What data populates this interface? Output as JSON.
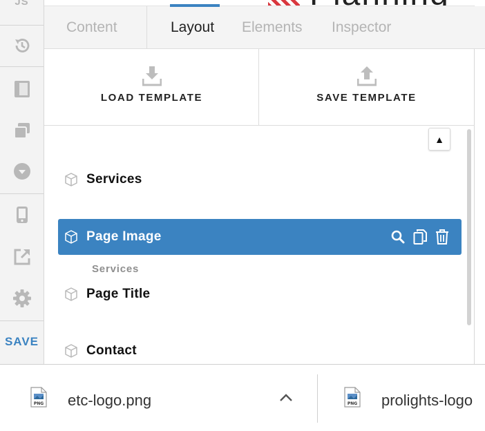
{
  "sidebar": {
    "top_label": "JS",
    "icons": [
      "history-icon",
      "sidebar-panel-icon",
      "stack-icon",
      "chevron-down-circle-icon",
      "mobile-icon",
      "external-link-icon",
      "gear-icon"
    ],
    "save_label": "SAVE"
  },
  "tabs": [
    "Content",
    "Layout",
    "Elements",
    "Inspector"
  ],
  "active_tab": "Layout",
  "templates": {
    "load_label": "LOAD TEMPLATE",
    "save_label": "SAVE TEMPLATE"
  },
  "layout_list": {
    "items": [
      {
        "name": "Services",
        "selected": false
      },
      {
        "name": "Page Image",
        "selected": true
      },
      {
        "name": "Page Title",
        "selected": false
      },
      {
        "name": "Contact",
        "selected": false
      }
    ],
    "group_label": "Services",
    "selected_actions": [
      "search-icon",
      "copy-icon",
      "trash-icon"
    ],
    "scroll_up_glyph": "▲"
  },
  "downloads": [
    {
      "name": "etc-logo.png",
      "icon_badge": "PNG"
    },
    {
      "name": "prolights-logo",
      "icon_badge": "PNG"
    }
  ],
  "colors": {
    "accent": "#3b83c1",
    "sidebar_bg": "#f3f3f3",
    "tabs_bg": "#f4f4f4",
    "inactive_text": "#b4b4b4"
  }
}
